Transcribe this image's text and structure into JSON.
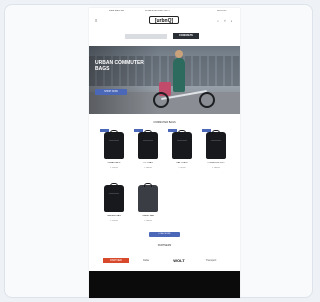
{
  "topbar": {
    "item1": "FREE SHIPPING",
    "item2": "30 DAYS RETURN POLICY",
    "item3": "SUPPORT"
  },
  "header": {
    "logo": "[urbnQ]",
    "menu_icon": "menu-icon",
    "actions": "search-icon account-icon cart-icon",
    "actions_glyphs": "⌕ ♡ ▪"
  },
  "promo": {
    "tag": "CONCRETE"
  },
  "hero": {
    "headline": "URBAN COMMUTER BAGS",
    "cta": "SHOP NOW"
  },
  "section_title": "COMMUTER BAGS",
  "products": [
    {
      "name": "URBAN PACK",
      "price": "€ 129,00"
    },
    {
      "name": "CITY BAG",
      "price": "€ 149,00"
    },
    {
      "name": "DAILY PACK",
      "price": "€ 99,00"
    },
    {
      "name": "COMMUTER PRO",
      "price": "€ 169,00"
    },
    {
      "name": "PANNIER BAG",
      "price": "€ 119,00"
    },
    {
      "name": "TRAVEL BAG",
      "price": "€ 139,00"
    }
  ],
  "load_more": "LOAD MORE",
  "partners": {
    "title": "PARTNERS",
    "items": [
      "PARTNER",
      "Cube",
      "WOLT",
      "Transport"
    ]
  },
  "colors": {
    "accent": "#4a67b8",
    "partner_orange": "#d8482a"
  }
}
